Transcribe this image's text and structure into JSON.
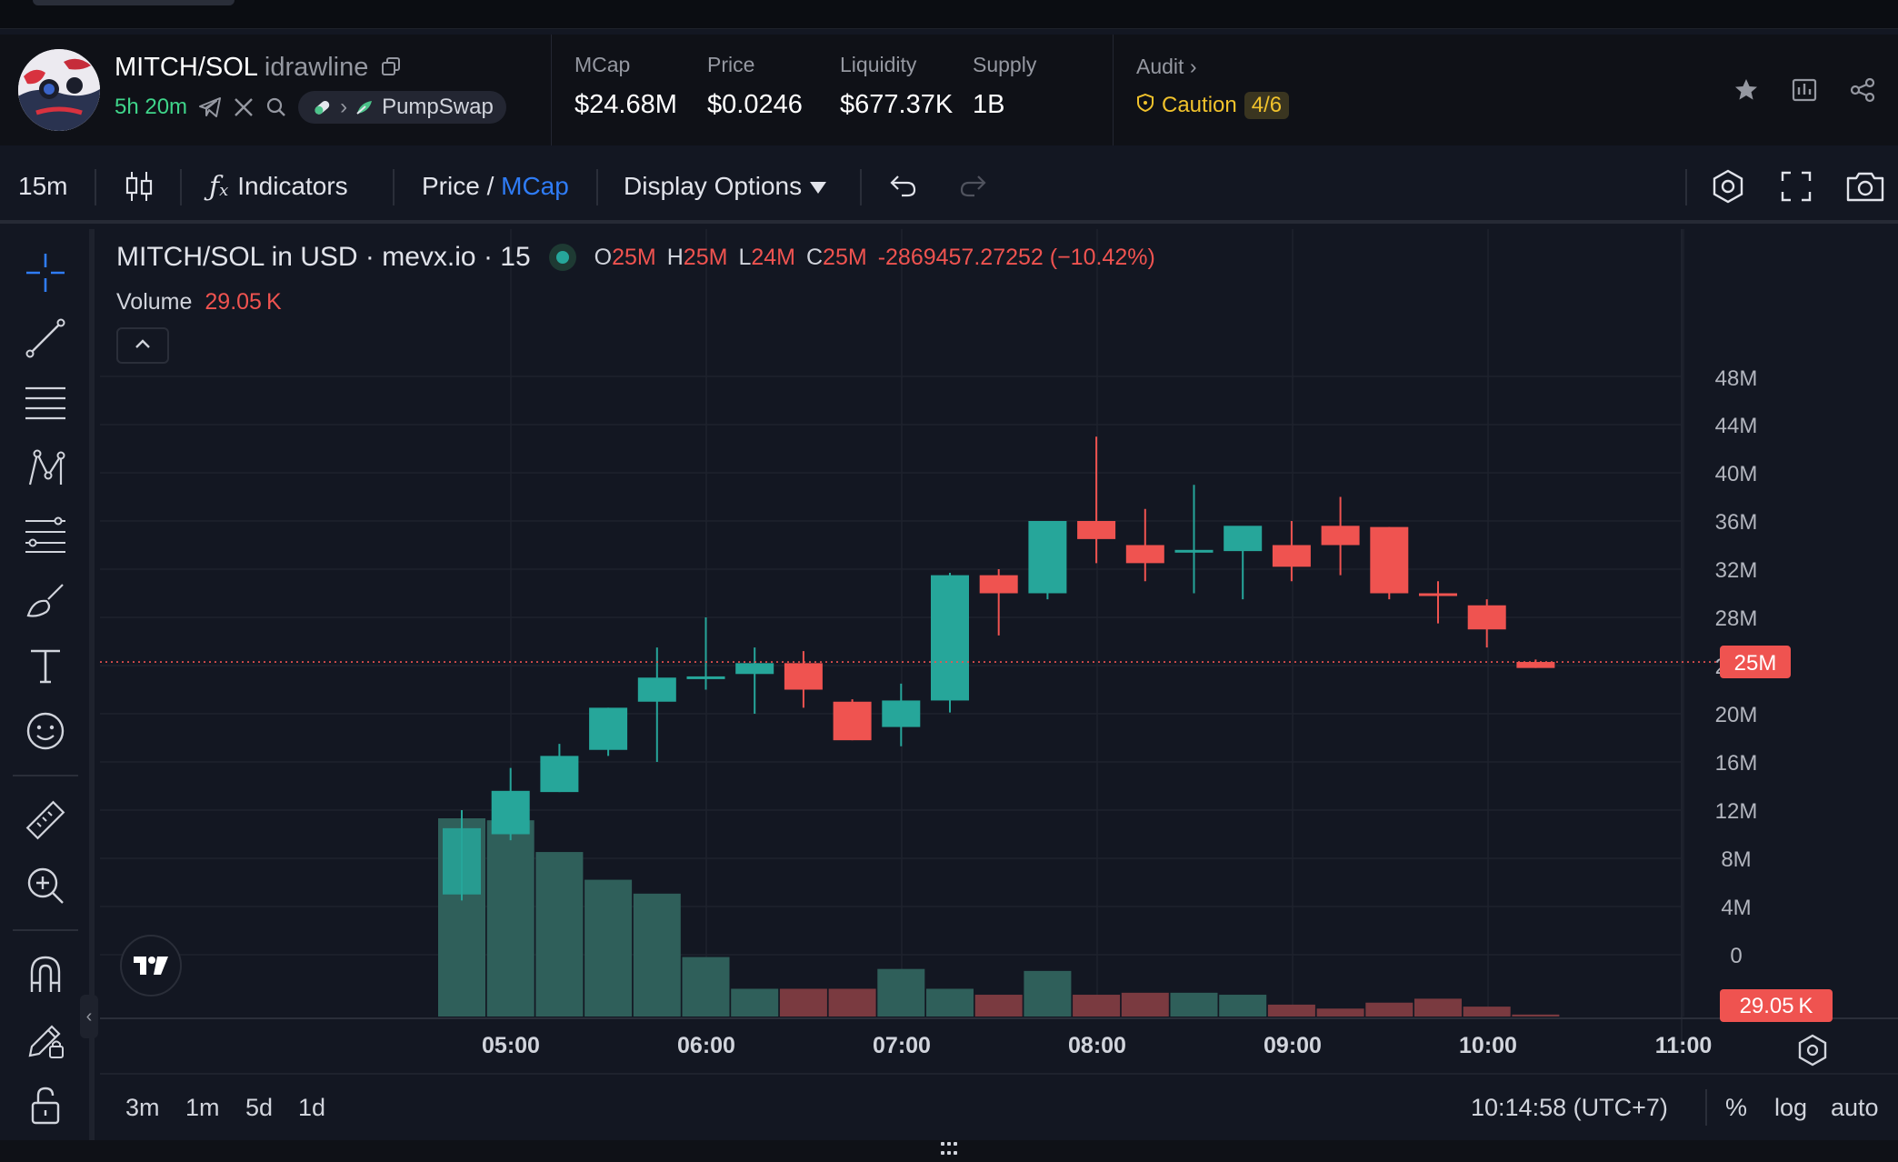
{
  "header": {
    "pair": "MITCH/SOL",
    "creator": "idrawline",
    "age": "5h 20m",
    "dex": "PumpSwap",
    "stats": [
      {
        "label": "MCap",
        "value": "$24.68M"
      },
      {
        "label": "Price",
        "value": "$0.0246"
      },
      {
        "label": "Liquidity",
        "value": "$677.37K"
      },
      {
        "label": "Supply",
        "value": "1B"
      }
    ],
    "audit": {
      "label": "Audit",
      "status": "Caution",
      "score": "4/6"
    }
  },
  "toolbar": {
    "interval": "15m",
    "indicators": "Indicators",
    "price": "Price",
    "slash": " / ",
    "mcap": "MCap",
    "display_options": "Display Options"
  },
  "legend": {
    "title": "MITCH/SOL in USD · mevx.io · 15",
    "o_label": "O",
    "o": "25M",
    "h_label": "H",
    "h": "25M",
    "l_label": "L",
    "l": "24M",
    "c_label": "C",
    "c": "25M",
    "change": "-2869457.27252 (−10.42%)",
    "volume_label": "Volume",
    "volume": "29.05 K"
  },
  "bottombar": {
    "ranges": [
      "3m",
      "1m",
      "5d",
      "1d"
    ],
    "clock": "10:14:58 (UTC+7)",
    "percent": "%",
    "log": "log",
    "auto": "auto"
  },
  "colors": {
    "up": "#26a69a",
    "down": "#ef5350",
    "accent": "#2f7cf6",
    "caution": "#f0c22c"
  },
  "chart_data": {
    "type": "candlestick",
    "x": [
      "04:30",
      "04:45",
      "05:00",
      "05:15",
      "05:30",
      "05:45",
      "06:00",
      "06:15",
      "06:30",
      "06:45",
      "07:00",
      "07:15",
      "07:30",
      "07:45",
      "08:00",
      "08:15",
      "08:30",
      "08:45",
      "09:00",
      "09:15",
      "09:30",
      "09:45",
      "10:00"
    ],
    "open": [
      5,
      10,
      13.5,
      17,
      21,
      23,
      23.3,
      24.2,
      21,
      18.9,
      21.1,
      31.5,
      30,
      36,
      34,
      33.5,
      33.5,
      34,
      35.6,
      35.5,
      30,
      29,
      24.3
    ],
    "high": [
      12,
      15.5,
      17.5,
      20.5,
      25.5,
      28,
      25.5,
      25.2,
      21.2,
      22.5,
      31.7,
      32,
      36,
      43,
      37,
      39,
      35.5,
      36,
      38,
      35.5,
      31,
      29.5,
      24.5
    ],
    "low": [
      4.5,
      9.5,
      13.5,
      16.5,
      16,
      22,
      20,
      20.5,
      17.8,
      17.3,
      20.1,
      26.5,
      29.5,
      32.5,
      31,
      30,
      29.5,
      31,
      31.5,
      29.5,
      27.5,
      25.5,
      23.8
    ],
    "close": [
      10.5,
      13.6,
      16.5,
      20.5,
      23,
      23.1,
      24.2,
      22,
      17.8,
      21.1,
      31.5,
      30,
      36,
      34.5,
      32.5,
      33.6,
      35.6,
      32.2,
      34,
      30,
      29.8,
      27,
      23.8
    ],
    "volume": [
      100,
      99,
      83,
      69,
      62,
      30,
      14,
      14,
      14,
      24,
      14,
      11,
      23,
      11,
      12,
      12,
      11,
      6,
      4,
      7,
      9,
      5,
      1
    ],
    "yaxis_ticks": [
      "44M",
      "40M",
      "36M",
      "32M",
      "28M",
      "24M",
      "20M",
      "16M",
      "12M",
      "8M",
      "4M",
      "0"
    ],
    "xaxis_ticks": [
      "05:00",
      "06:00",
      "07:00",
      "08:00",
      "09:00",
      "10:00",
      "11:00"
    ],
    "last_price_label": "25M",
    "last_volume_label": "29.05 K",
    "top_partial_tick": "48M",
    "bottom_partial_tick": "0"
  }
}
